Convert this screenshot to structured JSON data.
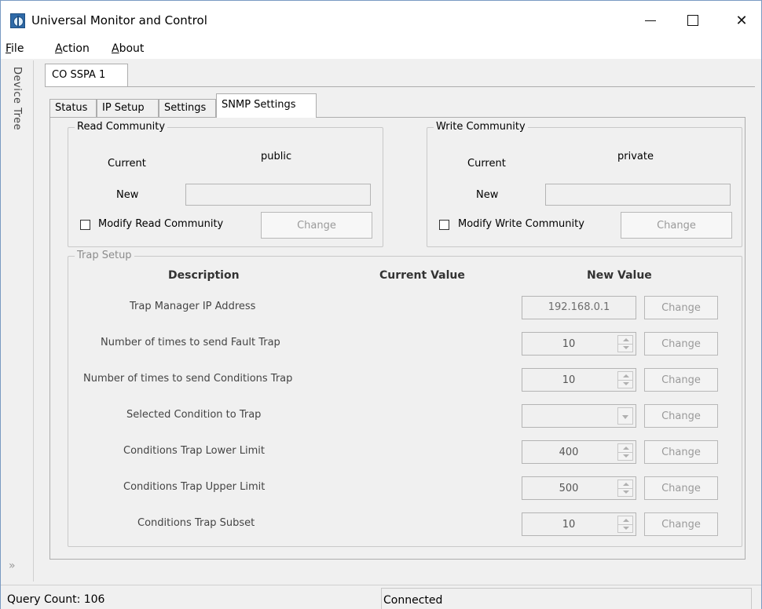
{
  "window": {
    "title": "Universal Monitor and Control",
    "minimize_symbol": "",
    "maximize_symbol": "",
    "close_symbol": "✕"
  },
  "menu": {
    "file": {
      "accel": "F",
      "rest": "ile"
    },
    "action": {
      "accel": "A",
      "rest": "ction"
    },
    "about": {
      "accel": "A",
      "rest": "bout"
    }
  },
  "sidebar": {
    "label": "Device Tree",
    "expand_glyph": "»"
  },
  "device_tab": {
    "label": "CO SSPA 1"
  },
  "tabs": [
    {
      "label": "Status"
    },
    {
      "label": "IP Setup"
    },
    {
      "label": "Settings"
    },
    {
      "label": "SNMP Settings"
    }
  ],
  "read_community": {
    "legend": "Read Community",
    "current_label": "Current",
    "current_value": "public",
    "new_label": "New",
    "new_value": "",
    "checkbox_label": "Modify Read Community",
    "change_label": "Change"
  },
  "write_community": {
    "legend": "Write Community",
    "current_label": "Current",
    "current_value": "private",
    "new_label": "New",
    "new_value": "",
    "checkbox_label": "Modify Write Community",
    "change_label": "Change"
  },
  "trap_setup": {
    "legend": "Trap Setup",
    "headers": {
      "description": "Description",
      "current_value": "Current Value",
      "new_value": "New Value"
    },
    "rows": [
      {
        "description": "Trap Manager IP Address",
        "new_value": "192.168.0.1",
        "control": "text",
        "change_label": "Change"
      },
      {
        "description": "Number of times to send Fault Trap",
        "new_value": "10",
        "control": "spin",
        "change_label": "Change"
      },
      {
        "description": "Number of times to send Conditions Trap",
        "new_value": "10",
        "control": "spin",
        "change_label": "Change"
      },
      {
        "description": "Selected Condition to Trap",
        "new_value": "",
        "control": "combo",
        "change_label": "Change"
      },
      {
        "description": "Conditions Trap Lower Limit",
        "new_value": "400",
        "control": "spin",
        "change_label": "Change"
      },
      {
        "description": "Conditions Trap Upper Limit",
        "new_value": "500",
        "control": "spin",
        "change_label": "Change"
      },
      {
        "description": "Conditions Trap Subset",
        "new_value": "10",
        "control": "spin",
        "change_label": "Change"
      }
    ]
  },
  "status": {
    "query_count": "Query Count: 106",
    "connection": "Connected"
  }
}
